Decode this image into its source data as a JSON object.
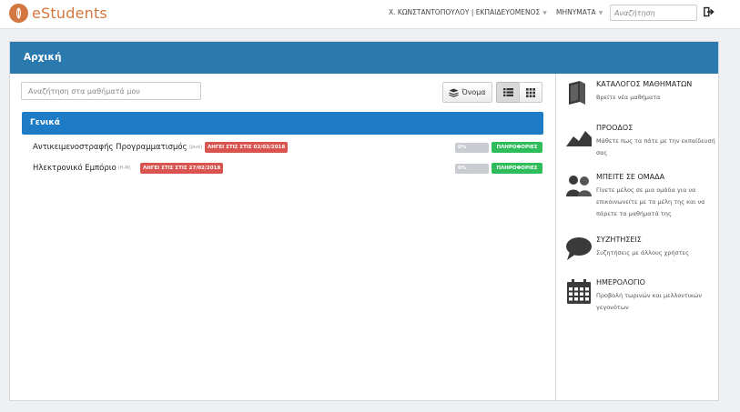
{
  "app": {
    "name": "eStudents"
  },
  "nav": {
    "user": "Χ. ΚΩΝΣΤΑΝΤΟΠΟΥΛΟΥ | ΕΚΠΑΙΔΕΥΟΜΕΝΟΣ",
    "messages": "ΜΗΝΥΜΑΤΑ",
    "search_placeholder": "Αναζήτηση"
  },
  "panel": {
    "title": "Αρχική",
    "search_placeholder": "Αναζήτηση στα μαθήματά μου",
    "sort_label": "Όνομα"
  },
  "category": {
    "title": "Γενικά"
  },
  "courses": [
    {
      "name": "Αντικειμενοστραφής Προγραμματισμός",
      "tag": "(Java)",
      "badge": "ΛΗΓΕΙ ΣΤΙΣ ΣΤΙΣ 02/03/2018",
      "progress_text": "0%",
      "progress": 0,
      "info": "ΠΛΗΡΟΦΟΡΙΕΣ"
    },
    {
      "name": "Ηλεκτρονικό Εμπόριο",
      "tag": "(Η-Μ)",
      "badge": "ΛΗΓΕΙ ΣΤΙΣ ΣΤΙΣ 27/02/2018",
      "progress_text": "0%",
      "progress": 0,
      "info": "ΠΛΗΡΟΦΟΡΙΕΣ"
    }
  ],
  "sidebar": [
    {
      "icon": "book-icon",
      "title": "ΚΑΤΑΛΟΓΟΣ ΜΑΘΗΜΑΤΩΝ",
      "desc": "Βρείτε νέα μαθήματα"
    },
    {
      "icon": "chart-area-icon",
      "title": "ΠΡΟΟΔΟΣ",
      "desc": "Μάθετε πως τα πάτε με την εκπαίδευσή σας"
    },
    {
      "icon": "users-icon",
      "title": "ΜΠΕΙΤΕ ΣΕ ΟΜΑΔΑ",
      "desc": "Γίνετε μέλος σε μια ομάδα για να επικοινωνείτε με τα μέλη της και να πάρετε τα μαθήματά της"
    },
    {
      "icon": "chat-bubble-icon",
      "title": "ΣΥΖΗΤΗΣΕΙΣ",
      "desc": "Συζητήσεις με άλλους χρήστες"
    },
    {
      "icon": "calendar-icon",
      "title": "ΗΜΕΡΟΛΟΓΙΟ",
      "desc": "Προβολή τωρινών και μελλοντικών γεγονότων"
    }
  ],
  "colors": {
    "brand": "#d4763f",
    "header": "#2a7ab0",
    "category": "#1d7cc5",
    "badge": "#d9534f",
    "info": "#2fbd5b"
  }
}
